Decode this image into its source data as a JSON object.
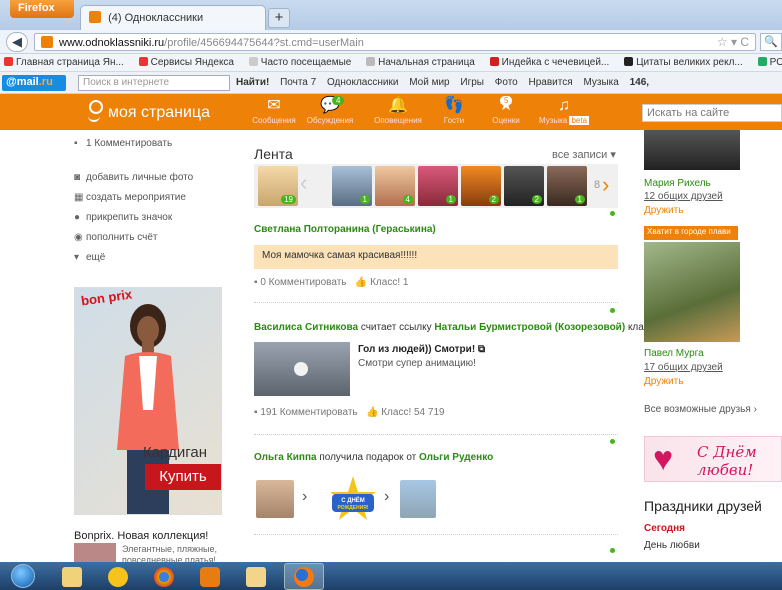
{
  "browser": {
    "menu_button": "Firefox",
    "tab_title": "(4) Одноклассники",
    "new_tab": "+",
    "url_domain": "www.odnoklassniki.ru",
    "url_path": "/profile/456694475644?st.cmd=userMain"
  },
  "bookmarks": [
    "Главная страница Ян...",
    "Сервисы Яндекса",
    "Часто посещаемые",
    "Начальная страница",
    "Индейка с чечевицей...",
    "Цитаты великих рекл...",
    "PONY EXPRESS Росси..."
  ],
  "mailbar": {
    "logo": "@mail",
    "logo_suffix": ".ru",
    "search_placeholder": "Поиск в интернете",
    "find": "Найти!",
    "items": [
      "Почта 7",
      "Одноклассники",
      "Мой мир",
      "Игры",
      "Фото",
      "Нравится",
      "Музыка",
      "146,"
    ]
  },
  "header": {
    "logo_text": "моя страница",
    "nav": [
      {
        "label": "Сообщения",
        "icon": "envelope-icon"
      },
      {
        "label": "Обсуждения",
        "icon": "chat-icon",
        "badge": "4"
      },
      {
        "label": "Оповещения",
        "icon": "bell-icon"
      },
      {
        "label": "Гости",
        "icon": "footprints-icon"
      },
      {
        "label": "Оценки",
        "icon": "rating-icon",
        "badge": "5"
      },
      {
        "label": "Музыка",
        "icon": "music-icon",
        "tag": "beta"
      }
    ],
    "search_placeholder": "Искать на сайте"
  },
  "left": {
    "comment_link": "1 Комментировать",
    "links": [
      {
        "label": "добавить личные фото",
        "icon": "camera-icon"
      },
      {
        "label": "создать мероприятие",
        "icon": "calendar-icon"
      },
      {
        "label": "прикрепить значок",
        "icon": "badge-icon"
      },
      {
        "label": "пополнить счёт",
        "icon": "coin-icon"
      },
      {
        "label": "ещё",
        "icon": "chevron-down-icon"
      }
    ],
    "ad": {
      "brand": "bon prix",
      "product": "Кардиган",
      "buy": "Купить",
      "title": "Bonprix. Новая коллекция!",
      "text": "Элегантные, пляжные, повседневные платья!"
    }
  },
  "feed": {
    "title": "Лента",
    "all_entries": "все записи ▾",
    "strip_counts": [
      "19",
      "1",
      "4",
      "1",
      "2",
      "2",
      "1"
    ],
    "more_count": "8",
    "posts": [
      {
        "author": "Светлана Полторанина (Гераськина)",
        "text": "Моя мамочка самая красивая!!!!!!",
        "comments": "0 Комментировать",
        "likes": "Класс! 1"
      },
      {
        "author": "Василиса Ситникова",
        "action": "считает ссылку",
        "target": "Натальи Бурмистровой (Козорезовой)",
        "suffix": "классной",
        "video_title": "Гол из людей)) Смотри!",
        "video_desc": "Смотри супер анимацию!",
        "comments": "191 Комментировать",
        "likes": "Класс! 54 719"
      },
      {
        "author": "Ольга Киппа",
        "action": "получила подарок от",
        "target": "Ольги Руденко",
        "gift_text": "С ДНЁМ РОЖДЕНИЯ!"
      }
    ]
  },
  "right": {
    "friend1": {
      "name": "Мария Рихель",
      "mutual": "12 общих друзей",
      "add": "Дружить"
    },
    "banner": "Хватит в городе плави",
    "friend2": {
      "name": "Павел Мурга",
      "mutual": "17 общих друзей",
      "add": "Дружить"
    },
    "all_friends": "Все возможные друзья ›",
    "valentine": "С Днём любви!",
    "holidays_title": "Праздники друзей",
    "today": "Сегодня",
    "holiday": "День любви"
  }
}
